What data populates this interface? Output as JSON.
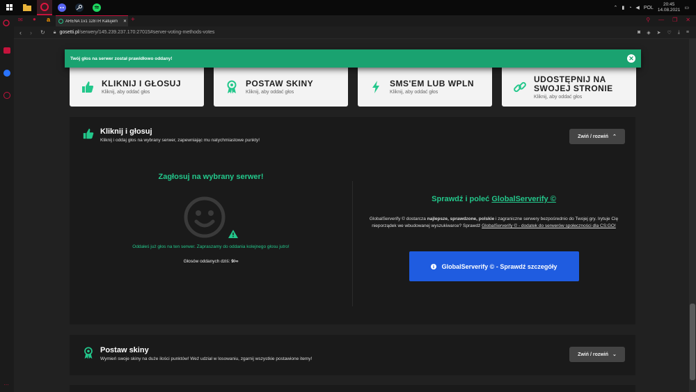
{
  "taskbar": {
    "clock_time": "20:45",
    "clock_date": "14.08.2021",
    "lang": "POL"
  },
  "browser": {
    "tab_title": "ARENA 1v1 128TR Katujem",
    "url_host": "gosetti.pl",
    "url_path": "/serwery/145.239.237.170:27015#server-voting-methods-votes"
  },
  "toast": {
    "message": "Twój głos na serwer został prawidłowo oddany!",
    "close_symbol": "✕"
  },
  "cards": [
    {
      "title": "KLIKNIJ I GŁOSUJ",
      "sub": "Kliknij, aby oddać głos",
      "icon": "thumbs-up-icon"
    },
    {
      "title": "POSTAW SKINY",
      "sub": "Kliknij, aby oddać głos",
      "icon": "award-icon"
    },
    {
      "title": "SMS'EM LUB WPLN",
      "sub": "Kliknij, aby oddać głos",
      "icon": "bolt-icon"
    },
    {
      "title_line1": "UDOSTĘPNIJ NA",
      "title_line2": "SWOJEJ STRONIE",
      "sub": "Kliknij, aby oddać głos",
      "icon": "link-icon"
    }
  ],
  "section1": {
    "title": "Kliknij i głosuj",
    "desc": "Kliknij i oddaj głos na wybrany serwer, zapewniając mu natychmiastowe punkty!",
    "collapse_label": "Zwiń / rozwiń",
    "left_title": "Zagłosuj na wybrany serwer!",
    "already_voted": "Oddałeś już głos na ten serwer. Zapraszamy do oddania kolejnego głosu jutro!",
    "votes_label": "Głosów oddanych dziś:",
    "votes_value": "9/∞",
    "right_title_prefix": "Sprawdź i poleć",
    "right_title_link": "GlobalServerify ©",
    "gs_p1": "GlobalServerify © dostarcza",
    "gs_bold": "najlepsze, sprawdzone, polskie",
    "gs_p2": "i zagraniczne serwery bezpośrednio do Twojej gry.",
    "gs_p3": "Irytuje Cię nieporządek we wbudowanej wyszukiwarce? Sprawdź",
    "gs_link": "GlobalServerify © - dodatek do serwerów społeczności dla CS:GO!",
    "button_label": "GlobalServerify © - Sprawdź szczegóły"
  },
  "section2": {
    "title": "Postaw skiny",
    "desc": "Wymień swoje skiny na duże ilości punktów! Weź udział w losowaniu, zgarnij wszystkie postawione itemy!",
    "collapse_label": "Zwiń / rozwiń"
  },
  "colors": {
    "accent_green": "#23c78b",
    "toast_green": "#1aa270",
    "button_blue": "#1f5ce0",
    "opera_red": "#c4133c"
  }
}
